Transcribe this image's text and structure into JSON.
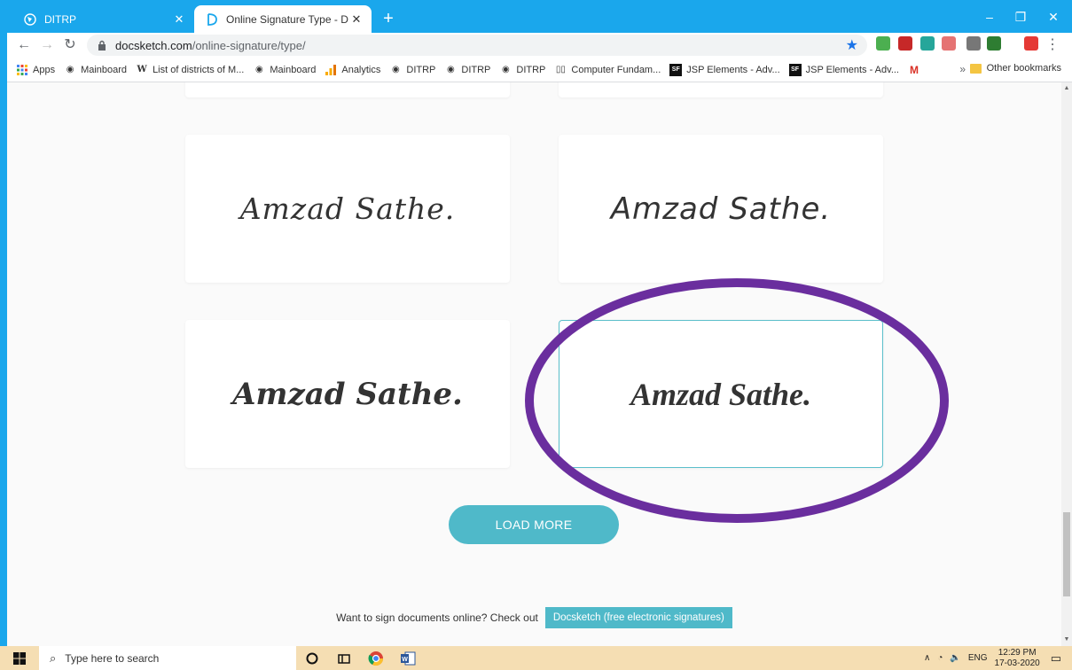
{
  "tabs": [
    {
      "title": "DITRP",
      "icon": "globe-icon"
    },
    {
      "title": "Online Signature Type - Docsketch",
      "icon": "docsketch-logo-icon"
    }
  ],
  "address": {
    "host": "docsketch.com",
    "path": "/online-signature/type/"
  },
  "bookmarks": [
    {
      "label": "Apps",
      "icon": "apps-grid-icon"
    },
    {
      "label": "Mainboard",
      "icon": "globe-icon"
    },
    {
      "label": "List of districts of M...",
      "icon": "wikipedia-icon"
    },
    {
      "label": "Mainboard",
      "icon": "globe-icon"
    },
    {
      "label": "Analytics",
      "icon": "analytics-icon"
    },
    {
      "label": "DITRP",
      "icon": "globe-icon"
    },
    {
      "label": "DITRP",
      "icon": "globe-icon"
    },
    {
      "label": "DITRP",
      "icon": "globe-icon"
    },
    {
      "label": "Computer Fundam...",
      "icon": "book-icon"
    },
    {
      "label": "JSP Elements - Adv...",
      "icon": "sf-icon"
    },
    {
      "label": "JSP Elements - Adv...",
      "icon": "sf-icon"
    },
    {
      "label": "",
      "icon": "gmail-icon"
    }
  ],
  "bookmarks_other": "Other bookmarks",
  "signatures": [
    {
      "text": "Amzad Sathe.",
      "style": "thin-script"
    },
    {
      "text": "Amzad Sathe.",
      "style": "handwritten"
    },
    {
      "text": "Amzad Sathe.",
      "style": "bold-brush"
    },
    {
      "text": "Amzad Sathe.",
      "style": "calligraphy",
      "selected": true
    }
  ],
  "load_more": "LOAD MORE",
  "footer": {
    "text": "Want to sign documents online? Check out",
    "link": "Docsketch (free electronic signatures)"
  },
  "taskbar": {
    "search_placeholder": "Type here to search",
    "lang": "ENG",
    "time": "12:29 PM",
    "date": "17-03-2020"
  },
  "colors": {
    "accent": "#4fb9c9",
    "annotation": "#6a2e9e",
    "desktop": "#1aa7ec"
  }
}
